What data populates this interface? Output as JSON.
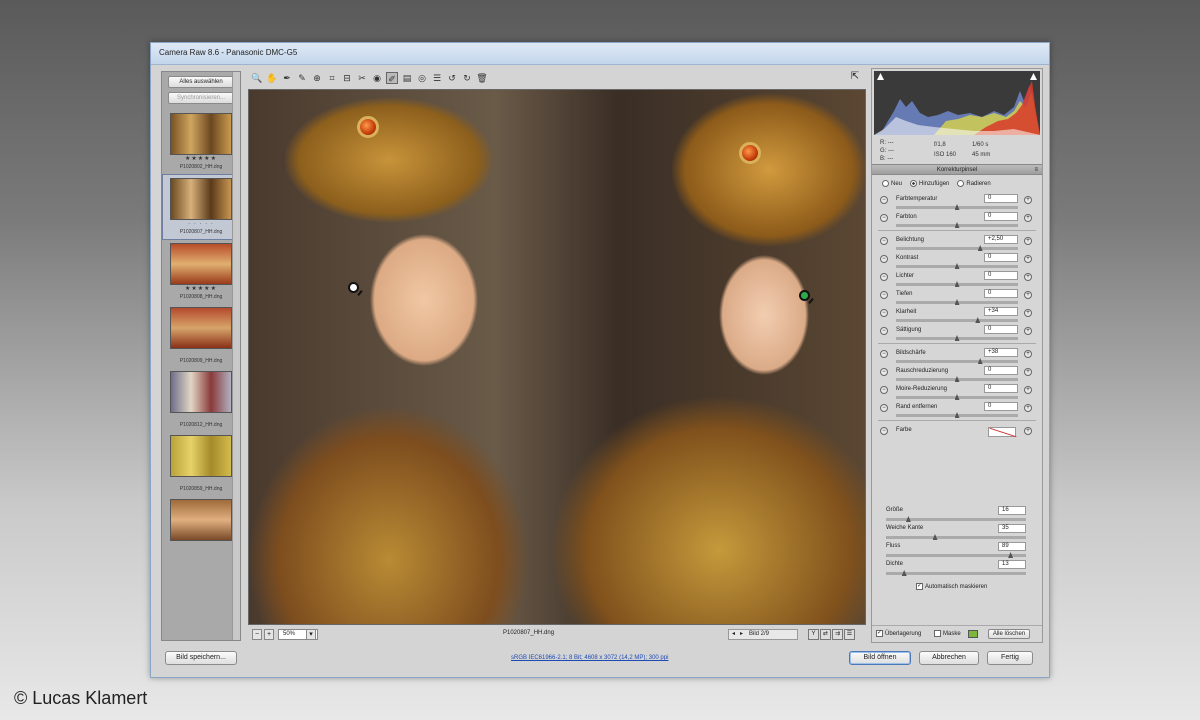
{
  "window": {
    "title": "Camera Raw 8.6 - Panasonic DMC-G5"
  },
  "filmstrip": {
    "select_all_label": "Alles auswählen",
    "sync_label": "Synchronisieren...",
    "thumbs": [
      {
        "stars": "★★★★★",
        "file": "P1020802_HH.dng",
        "selected": false
      },
      {
        "stars": "· · · · ·",
        "file": "P1020807_HH.dng",
        "selected": true
      },
      {
        "stars": "★★★★★",
        "file": "P1020808_HH.dng",
        "selected": false
      },
      {
        "stars": "",
        "file": "P1020809_HH.dng",
        "selected": false
      },
      {
        "stars": "",
        "file": "P1020812_HH.dng",
        "selected": false
      },
      {
        "stars": "",
        "file": "P1020859_HH.dng",
        "selected": false
      },
      {
        "stars": "",
        "file": "",
        "selected": false
      }
    ]
  },
  "toolbar": {
    "tools": [
      {
        "name": "zoom-tool-icon",
        "glyph": "🔍"
      },
      {
        "name": "hand-tool-icon",
        "glyph": "✋"
      },
      {
        "name": "white-balance-tool-icon",
        "glyph": "✒"
      },
      {
        "name": "color-sampler-tool-icon",
        "glyph": "✎"
      },
      {
        "name": "targeted-adjustment-tool-icon",
        "glyph": "⊕"
      },
      {
        "name": "crop-tool-icon",
        "glyph": "⌗"
      },
      {
        "name": "straighten-tool-icon",
        "glyph": "⊟"
      },
      {
        "name": "spot-removal-tool-icon",
        "glyph": "✂"
      },
      {
        "name": "red-eye-tool-icon",
        "glyph": "◉"
      },
      {
        "name": "adjustment-brush-tool-icon",
        "glyph": "✐"
      },
      {
        "name": "graduated-filter-tool-icon",
        "glyph": "▤"
      },
      {
        "name": "radial-filter-tool-icon",
        "glyph": "◎"
      },
      {
        "name": "preferences-icon",
        "glyph": "☰"
      },
      {
        "name": "rotate-ccw-icon",
        "glyph": "↺"
      },
      {
        "name": "rotate-cw-icon",
        "glyph": "↻"
      },
      {
        "name": "trash-icon",
        "glyph": "🗑"
      }
    ],
    "active_index": 9,
    "fullscreen_glyph": "⇱"
  },
  "image_status": {
    "zoom": "50%",
    "filename": "P1020807_HH.dng",
    "image_counter": "Bild 2/9"
  },
  "panel": {
    "readout": {
      "r": "R:  ---",
      "g": "G:  ---",
      "b": "B:  ---",
      "aperture": "f/1,8",
      "shutter": "1/60 s",
      "iso": "ISO 160",
      "focal": "45 mm"
    },
    "title": "Korrekturpinsel",
    "modes": [
      {
        "label": "Neu",
        "on": false
      },
      {
        "label": "Hinzufügen",
        "on": true
      },
      {
        "label": "Radieren",
        "on": false
      }
    ],
    "groups": [
      [
        {
          "label": "Farbtemperatur",
          "value": "0",
          "pos": 0.5
        },
        {
          "label": "Farbton",
          "value": "0",
          "pos": 0.5
        }
      ],
      [
        {
          "label": "Belichtung",
          "value": "+2,50",
          "pos": 0.69
        },
        {
          "label": "Kontrast",
          "value": "0",
          "pos": 0.5
        },
        {
          "label": "Lichter",
          "value": "0",
          "pos": 0.5
        },
        {
          "label": "Tiefen",
          "value": "0",
          "pos": 0.5
        },
        {
          "label": "Klarheit",
          "value": "+34",
          "pos": 0.67
        },
        {
          "label": "Sättigung",
          "value": "0",
          "pos": 0.5
        }
      ],
      [
        {
          "label": "Bildschärfe",
          "value": "+38",
          "pos": 0.69
        },
        {
          "label": "Rauschreduzierung",
          "value": "0",
          "pos": 0.5
        },
        {
          "label": "Moire-Reduzierung",
          "value": "0",
          "pos": 0.5
        },
        {
          "label": "Rand entfernen",
          "value": "0",
          "pos": 0.5
        }
      ]
    ],
    "color_label": "Farbe",
    "brush": [
      {
        "label": "Größe",
        "value": "16",
        "pos": 0.16
      },
      {
        "label": "Weiche Kante",
        "value": "35",
        "pos": 0.35
      },
      {
        "label": "Fluss",
        "value": "89",
        "pos": 0.89
      },
      {
        "label": "Dichte",
        "value": "13",
        "pos": 0.13
      }
    ],
    "automask_label": "Automatisch maskieren",
    "overlay_label": "Überlagerung",
    "mask_label": "Maske",
    "mask_color": "#7cb73b",
    "clear_all_label": "Alle löschen"
  },
  "footer": {
    "save_label": "Bild speichern...",
    "workflow_link": "sRGB IEC61966-2.1; 8 Bit; 4608 x 3072 (14,2 MP); 300 ppi",
    "open_label": "Bild öffnen",
    "cancel_label": "Abbrechen",
    "done_label": "Fertig"
  },
  "copyright": "© Lucas Klamert"
}
